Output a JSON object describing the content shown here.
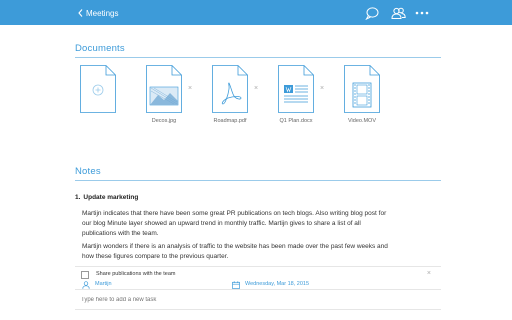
{
  "header": {
    "back_label": "Meetings",
    "icons": [
      "chat-icon",
      "people-icon",
      "more-icon"
    ]
  },
  "documents": {
    "title": "Documents",
    "items": [
      {
        "name": "",
        "type": "add"
      },
      {
        "name": "Decos.jpg",
        "type": "image"
      },
      {
        "name": "Roadmap.pdf",
        "type": "pdf"
      },
      {
        "name": "Q1 Plan.docx",
        "type": "word"
      },
      {
        "name": "Video.MOV",
        "type": "video"
      }
    ]
  },
  "notes": {
    "title": "Notes",
    "items": [
      {
        "number": "1.",
        "heading": "Update marketing",
        "paragraphs": [
          [
            "Martijn indicates that there have been some great PR publications on tech blogs. Also writing blog post for",
            "our blog Minute layer showed an upward trend in monthly traffic. Martijn gives to share a list of all",
            "publications with the team."
          ],
          [
            "Martijn wonders if there is an analysis of traffic to the website has been made over the past few weeks and",
            "how these figures compare to the previous quarter."
          ]
        ],
        "task": {
          "title": "Share publications with the team",
          "assignee": "Martijn",
          "date": "Wednesday, Mar 18, 2015",
          "checked": false
        }
      }
    ],
    "new_task_placeholder": "Type here to add a new task"
  },
  "colors": {
    "accent": "#3d9bd9",
    "divider": "#9bcbea"
  }
}
